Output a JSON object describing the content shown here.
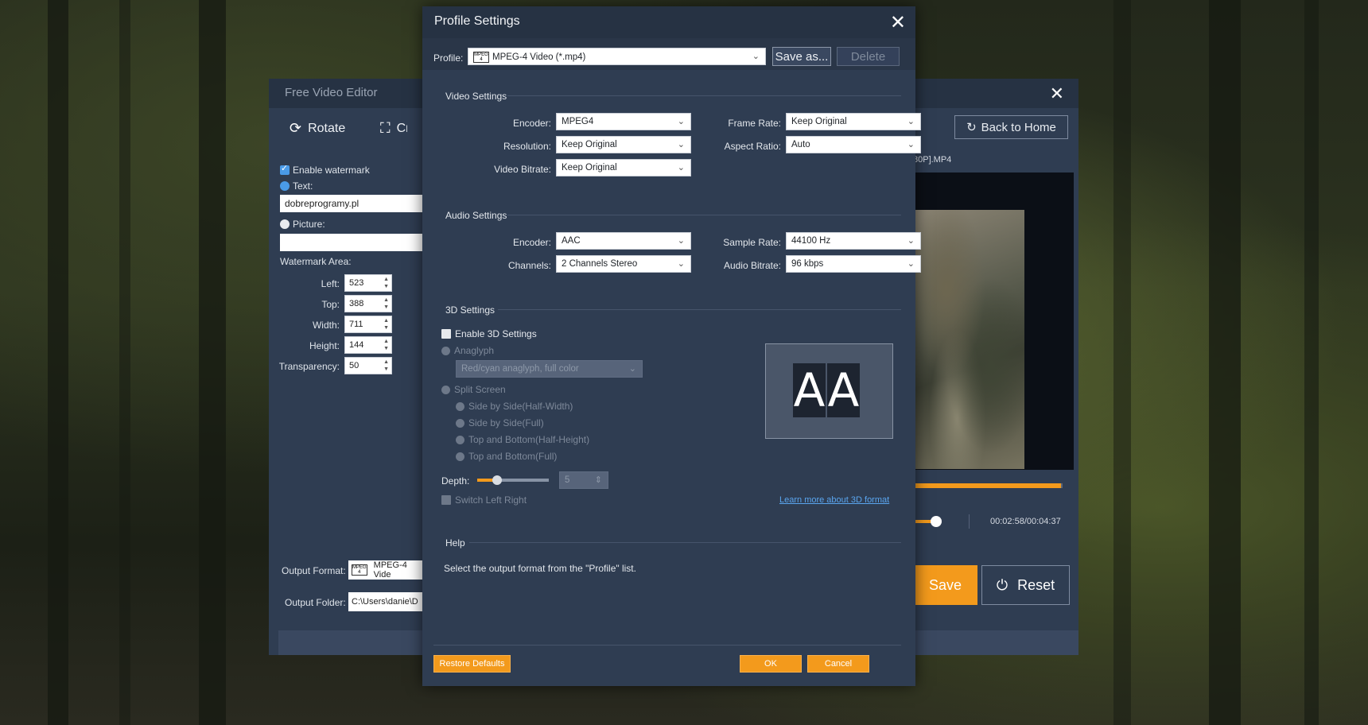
{
  "back_window": {
    "title": "Free Video Editor",
    "tools": [
      {
        "label": "Rotate",
        "icon": "rotate-icon"
      },
      {
        "label": "Crop",
        "icon": "crop-icon"
      }
    ],
    "back_home_label": "Back to Home",
    "filename_partial": "80P].MP4",
    "progress_fraction": 0.99,
    "time_display": "00:02:58/00:04:37",
    "save_label": "Save",
    "reset_label": "Reset",
    "watermark": {
      "enable_label": "Enable watermark",
      "enabled": true,
      "text_label": "Text:",
      "text_value": "dobreprogramy.pl",
      "picture_label": "Picture:",
      "area_label": "Watermark Area:",
      "left_label": "Left:",
      "left_value": "523",
      "top_label": "Top:",
      "top_value": "388",
      "width_label": "Width:",
      "width_value": "711",
      "height_label": "Height:",
      "height_value": "144",
      "transparency_label": "Transparency:",
      "transparency_value": "50"
    },
    "output_format_label": "Output Format:",
    "output_format_value": "MPEG-4 Vide",
    "output_folder_label": "Output Folder:",
    "output_folder_value": "C:\\Users\\danie\\D"
  },
  "dialog": {
    "title": "Profile Settings",
    "profile_label": "Profile:",
    "profile_value": "MPEG-4 Video (*.mp4)",
    "save_as_label": "Save as...",
    "delete_label": "Delete",
    "video": {
      "section": "Video Settings",
      "encoder_label": "Encoder:",
      "encoder_value": "MPEG4",
      "resolution_label": "Resolution:",
      "resolution_value": "Keep Original",
      "bitrate_label": "Video Bitrate:",
      "bitrate_value": "Keep Original",
      "frame_rate_label": "Frame Rate:",
      "frame_rate_value": "Keep Original",
      "aspect_label": "Aspect Ratio:",
      "aspect_value": "Auto"
    },
    "audio": {
      "section": "Audio Settings",
      "encoder_label": "Encoder:",
      "encoder_value": "AAC",
      "channels_label": "Channels:",
      "channels_value": "2 Channels Stereo",
      "sample_rate_label": "Sample Rate:",
      "sample_rate_value": "44100 Hz",
      "bitrate_label": "Audio Bitrate:",
      "bitrate_value": "96 kbps"
    },
    "three_d": {
      "section": "3D Settings",
      "enable_label": "Enable 3D Settings",
      "anaglyph_label": "Anaglyph",
      "anaglyph_value": "Red/cyan anaglyph, full color",
      "split_label": "Split Screen",
      "split_options": [
        "Side by Side(Half-Width)",
        "Side by Side(Full)",
        "Top and Bottom(Half-Height)",
        "Top and Bottom(Full)"
      ],
      "depth_label": "Depth:",
      "depth_value": "5",
      "depth_fraction": 0.28,
      "switch_label": "Switch Left Right",
      "preview_letters": [
        "A",
        "A"
      ],
      "learn_more": "Learn more about 3D format"
    },
    "help": {
      "section": "Help",
      "text": "Select the output format from the \"Profile\" list."
    },
    "restore_label": "Restore Defaults",
    "ok_label": "OK",
    "cancel_label": "Cancel"
  }
}
